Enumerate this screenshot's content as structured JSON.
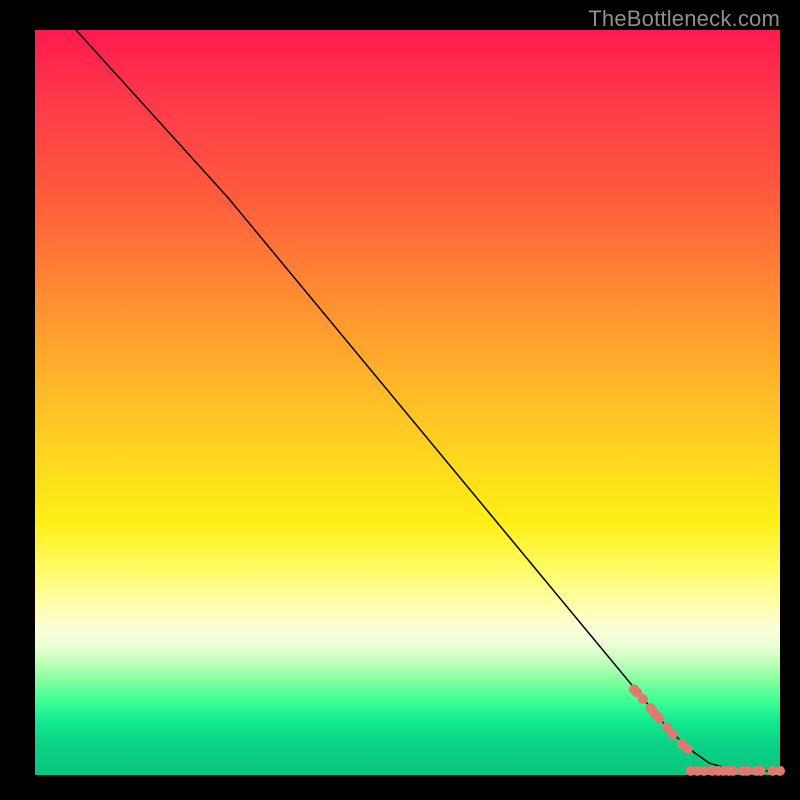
{
  "watermark": "TheBottleneck.com",
  "chart_data": {
    "type": "line",
    "title": "",
    "xlabel": "",
    "ylabel": "",
    "xlim": [
      0,
      100
    ],
    "ylim": [
      0,
      100
    ],
    "curve": {
      "name": "bottleneck-curve",
      "color": "#000000",
      "width": 1.5,
      "points": [
        {
          "x": 5.5,
          "y": 100
        },
        {
          "x": 25.9,
          "y": 77.5
        },
        {
          "x": 82.0,
          "y": 9.8
        },
        {
          "x": 85.1,
          "y": 6.1
        },
        {
          "x": 87.8,
          "y": 3.5
        },
        {
          "x": 90.5,
          "y": 1.6
        },
        {
          "x": 94.1,
          "y": 0.55
        },
        {
          "x": 100.0,
          "y": 0.55
        }
      ]
    },
    "points": {
      "name": "data-points",
      "color": "#e07a6e",
      "radius": 5.0,
      "xy": [
        [
          80.4,
          11.5
        ],
        [
          80.8,
          11.1
        ],
        [
          81.6,
          10.2
        ],
        [
          82.6,
          9.0
        ],
        [
          83.0,
          8.5
        ],
        [
          83.4,
          8.0
        ],
        [
          83.8,
          7.6
        ],
        [
          84.8,
          6.4
        ],
        [
          85.6,
          5.5
        ],
        [
          86.8,
          4.2
        ],
        [
          87.6,
          3.5
        ],
        [
          88.0,
          0.55
        ],
        [
          88.9,
          0.55
        ],
        [
          89.8,
          0.55
        ],
        [
          90.9,
          0.55
        ],
        [
          91.7,
          0.55
        ],
        [
          92.4,
          0.55
        ],
        [
          93.1,
          0.55
        ],
        [
          93.7,
          0.55
        ],
        [
          95.0,
          0.55
        ],
        [
          95.6,
          0.55
        ],
        [
          96.8,
          0.55
        ],
        [
          97.4,
          0.55
        ],
        [
          99.0,
          0.55
        ],
        [
          100.0,
          0.55
        ]
      ]
    }
  }
}
